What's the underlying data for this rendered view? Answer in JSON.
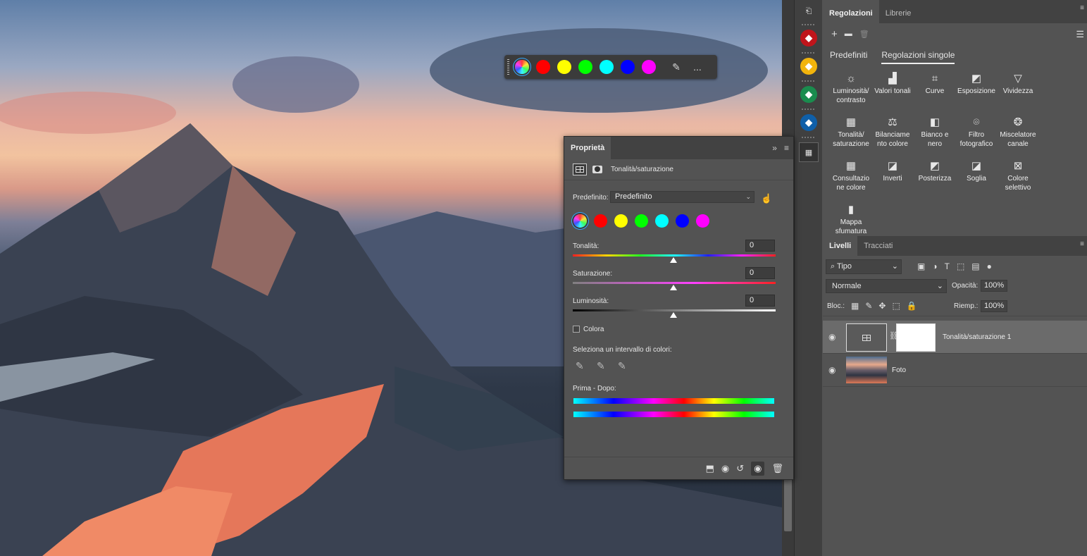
{
  "huebar": {
    "colors": [
      "#ff0000",
      "#ffff00",
      "#00ff00",
      "#00ffff",
      "#0000ff",
      "#ff00ff"
    ],
    "more": "..."
  },
  "properties": {
    "tab": "Proprietà",
    "title": "Tonalità/saturazione",
    "preset_label": "Predefinito:",
    "preset_value": "Predefinito",
    "hue_label": "Tonalità:",
    "hue_value": "0",
    "sat_label": "Saturazione:",
    "sat_value": "0",
    "lum_label": "Luminosità:",
    "lum_value": "0",
    "colorize_label": "Colora",
    "range_label": "Seleziona un intervallo di colori:",
    "before_after_label": "Prima - Dopo:"
  },
  "adjustments": {
    "tabs": [
      "Regolazioni",
      "Librerie"
    ],
    "subtabs": [
      "Predefiniti",
      "Regolazioni singole"
    ],
    "items": [
      {
        "label": "Luminosità/ contrasto",
        "icon": "sun-icon"
      },
      {
        "label": "Valori tonali",
        "icon": "levels-icon"
      },
      {
        "label": "Curve",
        "icon": "curves-icon"
      },
      {
        "label": "Esposizione",
        "icon": "exposure-icon"
      },
      {
        "label": "Vividezza",
        "icon": "vibrance-icon"
      },
      {
        "label": "Tonalità/ saturazione",
        "icon": "hue-sat-icon"
      },
      {
        "label": "Bilanciame nto colore",
        "icon": "balance-icon"
      },
      {
        "label": "Bianco e nero",
        "icon": "bw-icon"
      },
      {
        "label": "Filtro fotografico",
        "icon": "photo-filter-icon"
      },
      {
        "label": "Miscelatore canale",
        "icon": "channel-mixer-icon"
      },
      {
        "label": "Consultazio ne colore",
        "icon": "color-lookup-icon"
      },
      {
        "label": "Inverti",
        "icon": "invert-icon"
      },
      {
        "label": "Posterizza",
        "icon": "posterize-icon"
      },
      {
        "label": "Soglia",
        "icon": "threshold-icon"
      },
      {
        "label": "Colore selettivo",
        "icon": "selective-color-icon"
      },
      {
        "label": "Mappa sfumatura",
        "icon": "gradient-map-icon"
      }
    ]
  },
  "layers": {
    "tabs": [
      "Livelli",
      "Tracciati"
    ],
    "kind": "Tipo",
    "blend": "Normale",
    "opacity_label": "Opacità:",
    "opacity_value": "100%",
    "lock_label": "Bloc.:",
    "fill_label": "Riemp.:",
    "fill_value": "100%",
    "items": [
      {
        "name": "Tonalità/saturazione 1"
      },
      {
        "name": "Foto"
      }
    ]
  }
}
